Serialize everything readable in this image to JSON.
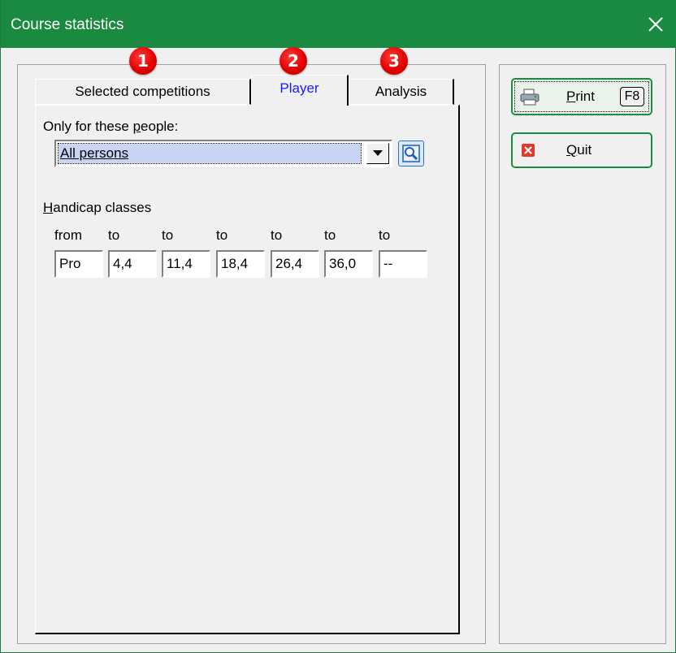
{
  "window": {
    "title": "Course statistics",
    "close_icon": "close-icon"
  },
  "tabs": [
    {
      "label": "Selected competitions",
      "badge": "1",
      "active": false
    },
    {
      "label": "Player",
      "badge": "2",
      "active": true
    },
    {
      "label": "Analysis",
      "badge": "3",
      "active": false
    }
  ],
  "player_tab": {
    "people_label_pre": "Only for these ",
    "people_label_key": "p",
    "people_label_post": "eople:",
    "people_combo": {
      "selected": "All persons"
    },
    "handicap_label_key": "H",
    "handicap_label_rest": "andicap classes",
    "handicap_headers": [
      "from",
      "to",
      "to",
      "to",
      "to",
      "to",
      "to"
    ],
    "handicap_values": [
      "Pro",
      "4,4",
      "11,4",
      "18,4",
      "26,4",
      "36,0",
      "--"
    ]
  },
  "buttons": {
    "print": {
      "key": "P",
      "rest": "rint",
      "shortcut": "F8",
      "icon": "printer-icon"
    },
    "quit": {
      "key": "Q",
      "rest": "uit",
      "icon": "cancel-icon"
    }
  },
  "colors": {
    "title_bar": "#1b8a41",
    "active_tab_text": "#1a1aff",
    "badge": "#e30000",
    "button_border": "#1c8c3e"
  }
}
